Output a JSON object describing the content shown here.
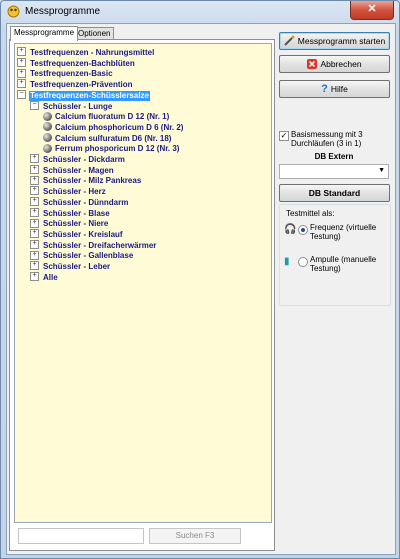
{
  "window": {
    "title": "Messprogramme",
    "close_label": "✕"
  },
  "tabs": [
    {
      "label": "Messprogramme",
      "active": true
    },
    {
      "label": "Optionen",
      "active": false
    }
  ],
  "tree": [
    {
      "label": "Testfrequenzen - Nahrungsmittel",
      "level": 0,
      "expander": "+",
      "selected": false
    },
    {
      "label": "Testfrequenzen-Bachblüten",
      "level": 0,
      "expander": "+",
      "selected": false
    },
    {
      "label": "Testfrequenzen-Basic",
      "level": 0,
      "expander": "+",
      "selected": false
    },
    {
      "label": "Testfrequenzen-Prävention",
      "level": 0,
      "expander": "+",
      "selected": false
    },
    {
      "label": "Testfrequenzen-Schüsslersalze",
      "level": 0,
      "expander": "−",
      "selected": true
    },
    {
      "label": "Schüssler - Lunge",
      "level": 1,
      "expander": "−",
      "selected": false
    },
    {
      "label": "Calcium fluoratum D 12 (Nr. 1)",
      "level": 2,
      "expander": "",
      "selected": false
    },
    {
      "label": "Calcium phosphoricum D 6 (Nr. 2)",
      "level": 2,
      "expander": "",
      "selected": false
    },
    {
      "label": "Calcium sulfuratum D6 (Nr. 18)",
      "level": 2,
      "expander": "",
      "selected": false
    },
    {
      "label": "Ferrum phosporicum D 12 (Nr. 3)",
      "level": 2,
      "expander": "",
      "selected": false
    },
    {
      "label": "Schüssler - Dickdarm",
      "level": 1,
      "expander": "+",
      "selected": false
    },
    {
      "label": "Schüssler - Magen",
      "level": 1,
      "expander": "+",
      "selected": false
    },
    {
      "label": "Schüssler - Milz Pankreas",
      "level": 1,
      "expander": "+",
      "selected": false
    },
    {
      "label": "Schüssler - Herz",
      "level": 1,
      "expander": "+",
      "selected": false
    },
    {
      "label": "Schüssler - Dünndarm",
      "level": 1,
      "expander": "+",
      "selected": false
    },
    {
      "label": "Schüssler - Blase",
      "level": 1,
      "expander": "+",
      "selected": false
    },
    {
      "label": "Schüssler - Niere",
      "level": 1,
      "expander": "+",
      "selected": false
    },
    {
      "label": "Schüssler - Kreislauf",
      "level": 1,
      "expander": "+",
      "selected": false
    },
    {
      "label": "Schüssler - Dreifacherwärmer",
      "level": 1,
      "expander": "+",
      "selected": false
    },
    {
      "label": "Schüssler - Gallenblase",
      "level": 1,
      "expander": "+",
      "selected": false
    },
    {
      "label": "Schüssler - Leber",
      "level": 1,
      "expander": "+",
      "selected": false
    },
    {
      "label": "Alle",
      "level": 1,
      "expander": "+",
      "selected": false
    }
  ],
  "search": {
    "value": "",
    "button_label": "Suchen F3"
  },
  "buttons": {
    "start": "Messprogramm starten",
    "cancel": "Abbrechen",
    "help": "Hilfe",
    "db_standard": "DB Standard"
  },
  "basis_checkbox": {
    "label": "Basismessung mit 3 Durchläufen (3 in 1)",
    "checked": true
  },
  "db_extern": {
    "label": "DB Extern",
    "value": ""
  },
  "testmittel": {
    "title": "Testmittel als:",
    "options": [
      {
        "label": "Frequenz (virtuelle Testung)",
        "icon": "headphones-icon",
        "selected": true
      },
      {
        "label": "Ampulle (manuelle Testung)",
        "icon": "ampoule-icon",
        "selected": false
      }
    ]
  },
  "colors": {
    "tree_bg": "#fffbd6",
    "tree_text": "#1b1b84",
    "selection": "#3399ff"
  }
}
